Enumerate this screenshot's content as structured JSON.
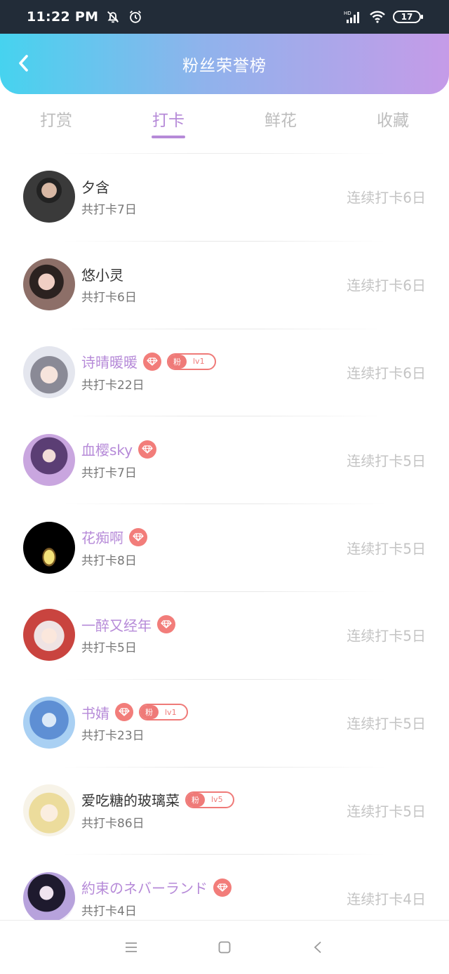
{
  "status": {
    "time": "11:22 PM",
    "battery": "17"
  },
  "header": {
    "title": "粉丝荣誉榜"
  },
  "tabs": [
    {
      "label": "打赏",
      "active": false
    },
    {
      "label": "打卡",
      "active": true
    },
    {
      "label": "鲜花",
      "active": false
    },
    {
      "label": "收藏",
      "active": false
    }
  ],
  "fans": [
    {
      "name": "夕含",
      "total": "共打卡7日",
      "streak": "连续打卡6日",
      "vip": false
    },
    {
      "name": "悠小灵",
      "total": "共打卡6日",
      "streak": "连续打卡6日",
      "vip": false
    },
    {
      "name": "诗晴暖暖",
      "total": "共打卡22日",
      "streak": "连续打卡6日",
      "vip": true,
      "badge": {
        "label": "粉",
        "level": "lv1"
      }
    },
    {
      "name": "血樱sky",
      "total": "共打卡7日",
      "streak": "连续打卡5日",
      "vip": true
    },
    {
      "name": "花痴啊",
      "total": "共打卡8日",
      "streak": "连续打卡5日",
      "vip": true
    },
    {
      "name": "一醉又经年",
      "total": "共打卡5日",
      "streak": "连续打卡5日",
      "vip": true
    },
    {
      "name": "书婧",
      "total": "共打卡23日",
      "streak": "连续打卡5日",
      "vip": true,
      "badge": {
        "label": "粉",
        "level": "lv1"
      }
    },
    {
      "name": "爱吃糖的玻璃菜",
      "total": "共打卡86日",
      "streak": "连续打卡5日",
      "vip": false,
      "badge": {
        "label": "粉",
        "level": "lv5"
      }
    },
    {
      "name": "約束のネバーランド",
      "total": "共打卡4日",
      "streak": "连续打卡4日",
      "vip": true
    }
  ],
  "colors": {
    "accent": "#b68ad8",
    "badge": "#ef7a78",
    "header_start": "#46d3ef",
    "header_end": "#c59be8"
  }
}
